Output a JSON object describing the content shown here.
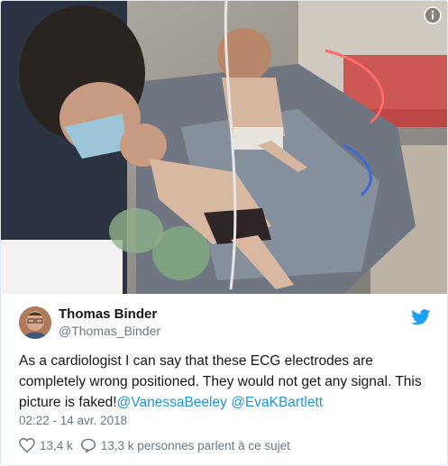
{
  "tweet": {
    "display_name": "Thomas Binder",
    "handle": "@Thomas_Binder",
    "text_prefix": "As a cardiologist I can say that these ECG electrodes are completely wrong positioned. They would not get any signal. This picture is faked!",
    "mentions": [
      "@VanessaBeeley",
      "@EvaKBartlett"
    ],
    "timestamp": "02:22 - 14 avr. 2018",
    "likes": "13,4 k",
    "replies_text": "13,3 k personnes parlent à ce sujet"
  },
  "colors": {
    "link": "#1b95e0",
    "text": "#14171a",
    "secondary": "#657786",
    "border": "#e1e8ed"
  },
  "icons": {
    "info": "info-icon",
    "brand": "twitter-bird-icon",
    "like": "heart-icon",
    "reply": "speech-bubble-icon"
  }
}
